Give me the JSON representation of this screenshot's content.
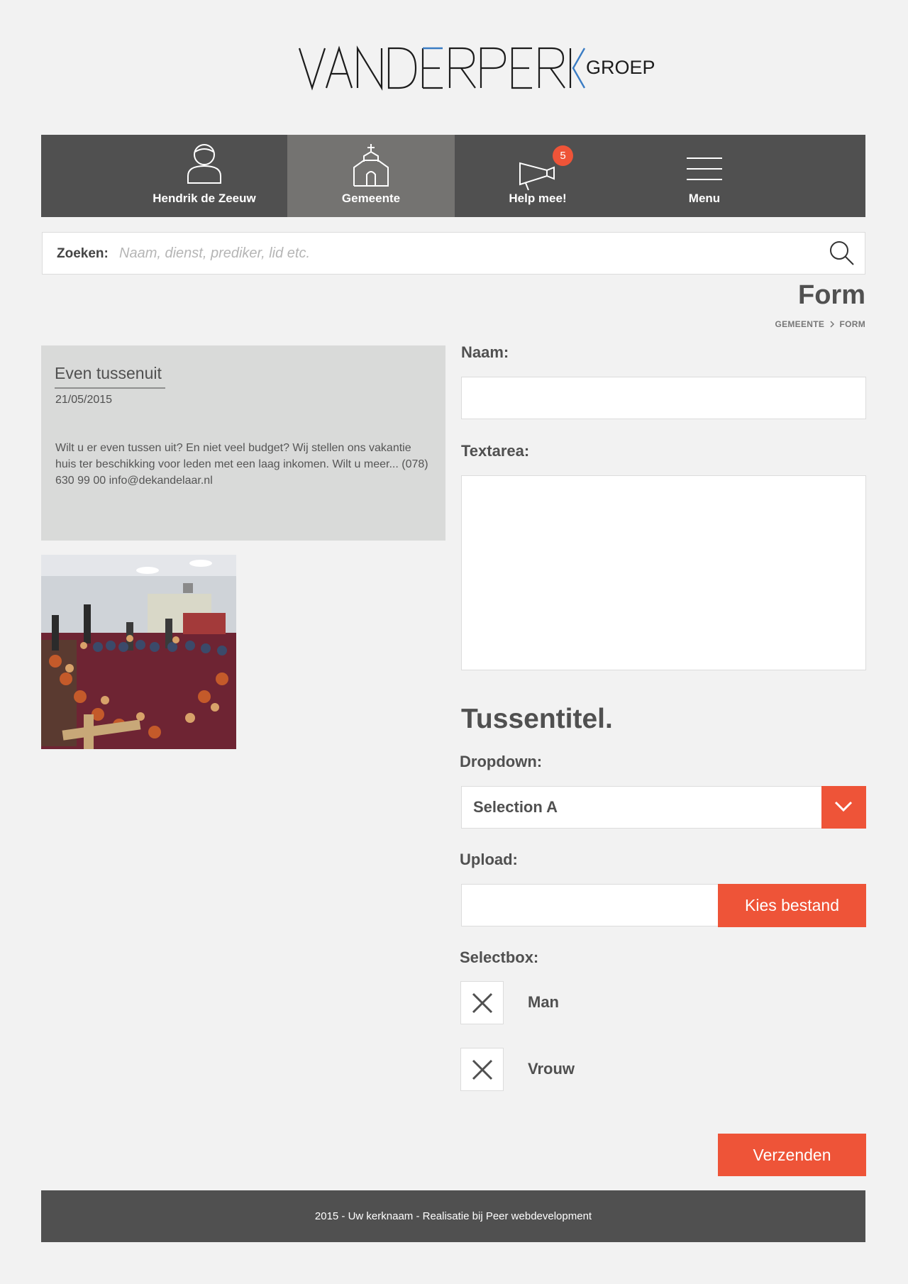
{
  "logo": {
    "name": "VANDERPERK",
    "suffix": "GROEP"
  },
  "nav": {
    "items": [
      {
        "label": "Hendrik de Zeeuw",
        "icon": "user-icon"
      },
      {
        "label": "Gemeente",
        "icon": "church-icon",
        "active": true
      },
      {
        "label": "Help mee!",
        "icon": "megaphone-icon",
        "badge": "5"
      },
      {
        "label": "Menu",
        "icon": "hamburger-menu-icon"
      }
    ]
  },
  "search": {
    "label": "Zoeken:",
    "placeholder": "Naam, dienst, prediker, lid etc.",
    "value": ""
  },
  "page": {
    "title": "Form",
    "breadcrumb": [
      "GEMEENTE",
      "FORM"
    ]
  },
  "card": {
    "title": "Even tussenuit",
    "date": "21/05/2015",
    "text": "Wilt u er even tussen uit? En niet veel budget? Wij stellen ons vakantie huis ter beschikking voor leden met een laag inkomen. Wilt u meer... (078) 630 99 00 info@dekandelaar.nl"
  },
  "form": {
    "naam_label": "Naam:",
    "naam_value": "",
    "textarea_label": "Textarea:",
    "textarea_value": "",
    "subtitle": "Tussentitel.",
    "dropdown_label": "Dropdown:",
    "dropdown_selected": "Selection A",
    "upload_label": "Upload:",
    "upload_button": "Kies bestand",
    "selectbox_label": "Selectbox:",
    "options": [
      {
        "label": "Man",
        "checked": true
      },
      {
        "label": "Vrouw",
        "checked": true
      }
    ],
    "submit": "Verzenden"
  },
  "footer": {
    "text": "2015 - Uw kerknaam - Realisatie bij Peer webdevelopment"
  },
  "colors": {
    "accent": "#ee5438",
    "nav_bg": "#505050",
    "nav_active": "#747371",
    "logo_accent": "#3a7cc4"
  }
}
